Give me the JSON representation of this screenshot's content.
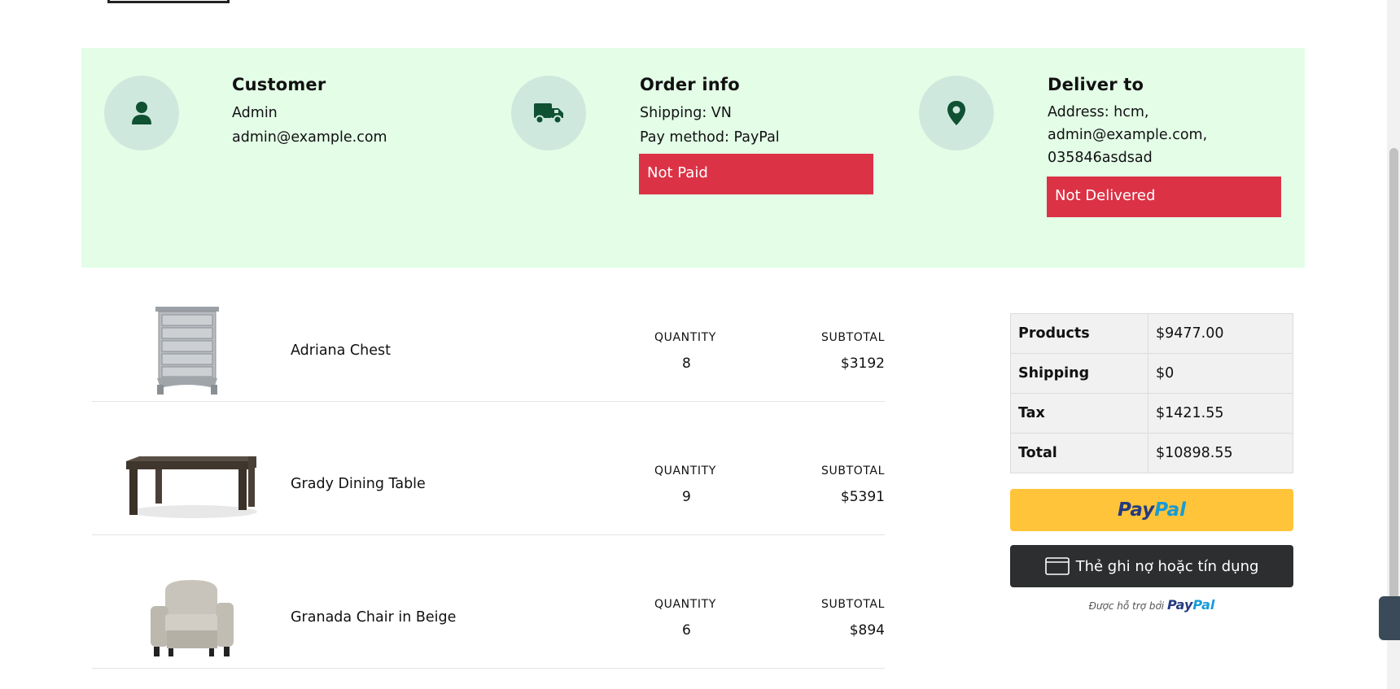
{
  "customer": {
    "title": "Customer",
    "name": "Admin",
    "email": "admin@example.com"
  },
  "order_info": {
    "title": "Order info",
    "shipping": "Shipping: VN",
    "pay_method": "Pay method: PayPal",
    "paid_status": "Not Paid"
  },
  "deliver_to": {
    "title": "Deliver to",
    "address_line1": "Address: hcm,",
    "address_line2": "admin@example.com,",
    "address_line3": "035846asdsad",
    "delivery_status": "Not Delivered"
  },
  "items": [
    {
      "name": "Adriana Chest",
      "quantity_label": "QUANTITY",
      "quantity": "8",
      "subtotal_label": "SUBTOTAL",
      "subtotal": "$3192"
    },
    {
      "name": "Grady Dining Table",
      "quantity_label": "QUANTITY",
      "quantity": "9",
      "subtotal_label": "SUBTOTAL",
      "subtotal": "$5391"
    },
    {
      "name": "Granada Chair in Beige",
      "quantity_label": "QUANTITY",
      "quantity": "6",
      "subtotal_label": "SUBTOTAL",
      "subtotal": "$894"
    }
  ],
  "summary": [
    {
      "label": "Products",
      "value": "$9477.00"
    },
    {
      "label": "Shipping",
      "value": "$0"
    },
    {
      "label": "Tax",
      "value": "$1421.55"
    },
    {
      "label": "Total",
      "value": "$10898.55"
    }
  ],
  "payment": {
    "paypal_pay": "Pay",
    "paypal_pal": "Pal",
    "card_label": "Thẻ ghi nợ hoặc tín dụng",
    "powered_by": "Được hỗ trợ bởi",
    "powered_pay": "Pay",
    "powered_pal": "Pal"
  },
  "icons": {
    "customer": "user-icon",
    "order": "truck-icon",
    "deliver": "map-pin-icon",
    "card": "credit-card-icon"
  },
  "colors": {
    "panel_bg": "#e3fde7",
    "icon_green": "#0f5132",
    "badge_red": "#dc3246",
    "paypal_yellow": "#ffc43a",
    "paypal_navy": "#253b80",
    "paypal_blue": "#179bd7"
  }
}
